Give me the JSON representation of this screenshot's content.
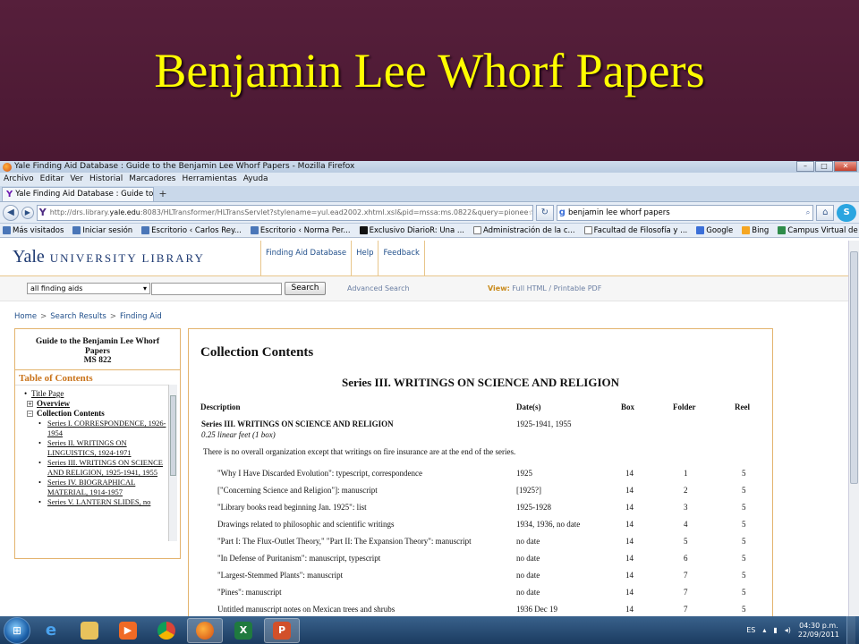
{
  "slide": {
    "title": "Benjamin Lee Whorf Papers"
  },
  "browser": {
    "window_title": "Yale Finding Aid Database : Guide to the Benjamin Lee Whorf Papers - Mozilla Firefox",
    "menu": [
      "Archivo",
      "Editar",
      "Ver",
      "Historial",
      "Marcadores",
      "Herramientas",
      "Ayuda"
    ],
    "tab_label": "Yale Finding Aid Database : Guide to the ...",
    "url_prefix": "http://drs.library.",
    "url_domain": "yale.edu",
    "url_rest": ":8083/HLTransformer/HLTransServlet?stylename=yul.ead2002.xhtml.xsl&pid=mssa:ms.0822&query=pionee",
    "search_value": "benjamin lee whorf papers",
    "bookmarks": [
      "Más visitados",
      "Iniciar sesión",
      "Escritorio ‹ Carlos Rey...",
      "Escritorio ‹ Norma Per...",
      "Exclusivo DiarioR: Una ...",
      "Administración de la c...",
      "Facultad de Filosofía y ...",
      "Google",
      "Bing",
      "Campus Virtual de Filo..."
    ]
  },
  "site": {
    "logo_yale": "Yale",
    "logo_rest": "UNIVERSITY LIBRARY",
    "nav": [
      "Finding Aid Database",
      "Help",
      "Feedback"
    ],
    "select_value": "all finding aids",
    "search_button": "Search",
    "advanced": "Advanced Search",
    "view_label": "View:",
    "view_full": "Full HTML",
    "view_sep": "/",
    "view_pdf": "Printable PDF",
    "breadcrumb": [
      "Home",
      "Search Results",
      "Finding Aid"
    ],
    "breadcrumb_sep": ">"
  },
  "sidebar": {
    "guide_title": "Guide to the Benjamin Lee Whorf Papers",
    "ms": "MS 822",
    "toc_heading": "Table of Contents",
    "items": [
      {
        "label": "Title Page",
        "marker": "•"
      },
      {
        "label": "Overview",
        "marker": "+"
      },
      {
        "label": "Collection Contents",
        "marker": "−"
      }
    ],
    "series": [
      "Series I. CORRESPONDENCE, 1926-1954",
      "Series II. WRITINGS ON LINGUISTICS, 1924-1971",
      "Series III. WRITINGS ON SCIENCE AND RELIGION, 1925-1941, 1955",
      "Series IV. BIOGRAPHICAL MATERIAL, 1914-1957",
      "Series V. LANTERN SLIDES, no"
    ]
  },
  "main": {
    "heading": "Collection Contents",
    "series_title": "Series III. WRITINGS ON SCIENCE AND RELIGION",
    "columns": [
      "Description",
      "Date(s)",
      "Box",
      "Folder",
      "Reel"
    ],
    "series_row": {
      "title": "Series III. WRITINGS ON SCIENCE AND RELIGION",
      "extent": "0.25 linear feet (1 box)",
      "dates": "1925-1941, 1955"
    },
    "intro": "There is no overall organization except that writings on fire insurance are at the end of the series.",
    "rows": [
      {
        "desc": "\"Why I Have Discarded Evolution\": typescript, correspondence",
        "date": "1925",
        "box": "14",
        "folder": "1",
        "reel": "5"
      },
      {
        "desc": "[\"Concerning Science and Religion\"]: manuscript",
        "date": "[1925?]",
        "box": "14",
        "folder": "2",
        "reel": "5"
      },
      {
        "desc": "\"Library books read beginning Jan. 1925\": list",
        "date": "1925-1928",
        "box": "14",
        "folder": "3",
        "reel": "5"
      },
      {
        "desc": "Drawings related to philosophic and scientific writings",
        "date": "1934, 1936, no date",
        "box": "14",
        "folder": "4",
        "reel": "5"
      },
      {
        "desc": "\"Part I: The Flux-Outlet Theory,\" \"Part II: The Expansion Theory\": manuscript",
        "date": "no date",
        "box": "14",
        "folder": "5",
        "reel": "5"
      },
      {
        "desc": "\"In Defense of Puritanism\": manuscript, typescript",
        "date": "no date",
        "box": "14",
        "folder": "6",
        "reel": "5"
      },
      {
        "desc": "\"Largest-Stemmed Plants\": manuscript",
        "date": "no date",
        "box": "14",
        "folder": "7",
        "reel": "5"
      },
      {
        "desc": "\"Pines\": manuscript",
        "date": "no date",
        "box": "14",
        "folder": "7",
        "reel": "5"
      },
      {
        "desc": "Untitled manuscript notes on Mexican trees and shrubs",
        "date": "1936 Dec 19",
        "box": "14",
        "folder": "7",
        "reel": "5"
      }
    ]
  },
  "taskbar": {
    "lang": "ES",
    "time": "04:30 p.m.",
    "date": "22/09/2011"
  }
}
